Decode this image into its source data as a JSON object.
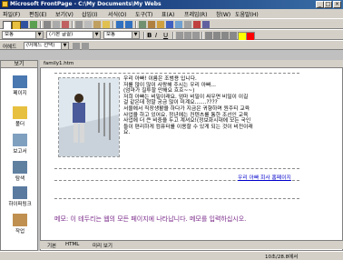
{
  "window": {
    "title": "Microsoft FrontPage - C:\\My Documents\\My Webs"
  },
  "menu": [
    "파일(F)",
    "편집(E)",
    "보기(V)",
    "삽입(I)",
    "서식(O)",
    "도구(T)",
    "표(A)",
    "프레임(R)",
    "창(W)",
    "도움말(H)"
  ],
  "format_bar": {
    "style_value": "보통",
    "font_value": "(기본 글꼴)",
    "size_value": "보통"
  },
  "address_bar": {
    "label": "어헤드",
    "value": "(어헤드 선택)"
  },
  "views_panel": {
    "header": "보기",
    "items": [
      "페이지",
      "폴더",
      "보고서",
      "탐색",
      "하이퍼링크",
      "작업"
    ]
  },
  "document": {
    "tab": "family1.htm",
    "paragraphs": [
      "우리 아빠! 이름은 조범용 입니다.",
      "저를 많이 많이 사랑해 주시는 우리 아빠...",
      "(엄마가 질투할 만해요 흐흐~~)",
      "저희 아빠는 비밀이래요. 엄마 비밀이 싸우면 비밀이 이길",
      "걸 같은데 정말 궁금 많이 미계요.......????",
      "서울에서 직장생활을 하다가 지금은 귀향하며 원주티 교육",
      "사업을 하고 있어요. 정년에는 컨텐츠를 통한 조선인 교육",
      "사업에 더 큰 비중을 두고 계셔요!(정보화시대에 모든 국인",
      "들이 편리하게 컴퓨터를 이용할 수 있게 되는 것이 비전이래",
      "요."
    ],
    "link": "우리 아빠 회사 홈페이지",
    "footer_note": "메모: 이 테두리는 웹의 모든 페이지에 나타납니다. 메모를 입력하십시오."
  },
  "bottom_tabs": [
    "기본",
    "HTML",
    "미리 보기"
  ],
  "status_bar": {
    "time": "10초/28.8에서"
  }
}
